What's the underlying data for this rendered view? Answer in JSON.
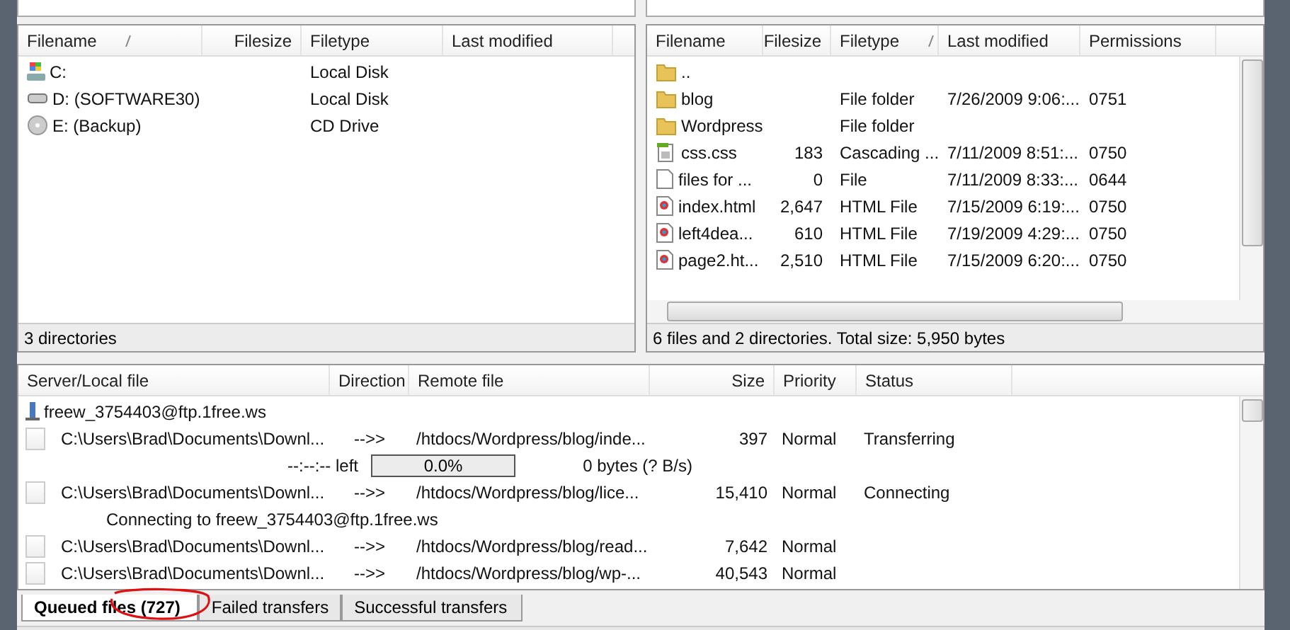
{
  "local": {
    "columns": [
      {
        "label": "Filename",
        "sorted": true
      },
      {
        "label": "Filesize",
        "sorted": false
      },
      {
        "label": "Filetype",
        "sorted": false
      },
      {
        "label": "Last modified",
        "sorted": false
      }
    ],
    "rows": [
      {
        "kind": "windows-drive",
        "name": "C:",
        "type": "Local Disk"
      },
      {
        "kind": "drive",
        "name": "D: (SOFTWARE30)",
        "type": "Local Disk"
      },
      {
        "kind": "cd",
        "name": "E: (Backup)",
        "type": "CD Drive"
      }
    ],
    "status": "3 directories"
  },
  "remote": {
    "columns": [
      {
        "label": "Filename",
        "sorted": false
      },
      {
        "label": "Filesize",
        "sorted": false
      },
      {
        "label": "Filetype",
        "sorted": true
      },
      {
        "label": "Last modified",
        "sorted": false
      },
      {
        "label": "Permissions",
        "sorted": false
      }
    ],
    "rows": [
      {
        "kind": "folder",
        "name": ".."
      },
      {
        "kind": "folder",
        "name": "blog",
        "type": "File folder",
        "modified": "7/26/2009 9:06:...",
        "perms": "0751"
      },
      {
        "kind": "folder",
        "name": "Wordpress",
        "type": "File folder"
      },
      {
        "kind": "css",
        "name": "css.css",
        "size": "183",
        "type": "Cascading ...",
        "modified": "7/11/2009 8:51:...",
        "perms": "0750"
      },
      {
        "kind": "file",
        "name": "files for ...",
        "size": "0",
        "type": "File",
        "modified": "7/11/2009 8:33:...",
        "perms": "0644"
      },
      {
        "kind": "html",
        "name": "index.html",
        "size": "2,647",
        "type": "HTML File",
        "modified": "7/15/2009 6:19:...",
        "perms": "0750"
      },
      {
        "kind": "html",
        "name": "left4dea...",
        "size": "610",
        "type": "HTML File",
        "modified": "7/19/2009 4:29:...",
        "perms": "0750"
      },
      {
        "kind": "html",
        "name": "page2.ht...",
        "size": "2,510",
        "type": "HTML File",
        "modified": "7/15/2009 6:20:...",
        "perms": "0750"
      }
    ],
    "status": "6 files and 2 directories. Total size: 5,950 bytes"
  },
  "queue": {
    "columns": [
      "Server/Local file",
      "Direction",
      "Remote file",
      "Size",
      "Priority",
      "Status"
    ],
    "rows": [
      {
        "kind": "server",
        "text": "freew_3754403@ftp.1free.ws"
      },
      {
        "kind": "file",
        "local": "C:\\Users\\Brad\\Documents\\Downl...",
        "direction": "-->>",
        "remote": "/htdocs/Wordpress/blog/inde...",
        "size": "397",
        "priority": "Normal",
        "status": "Transferring"
      },
      {
        "kind": "progress",
        "left": "--:--:-- left",
        "percent": "0.0%",
        "level": 0,
        "rate": "0 bytes (? B/s)"
      },
      {
        "kind": "file",
        "local": "C:\\Users\\Brad\\Documents\\Downl...",
        "direction": "-->>",
        "remote": "/htdocs/Wordpress/blog/lice...",
        "size": "15,410",
        "priority": "Normal",
        "status": "Connecting"
      },
      {
        "kind": "message",
        "text": "Connecting to freew_3754403@ftp.1free.ws"
      },
      {
        "kind": "file",
        "local": "C:\\Users\\Brad\\Documents\\Downl...",
        "direction": "-->>",
        "remote": "/htdocs/Wordpress/blog/read...",
        "size": "7,642",
        "priority": "Normal"
      },
      {
        "kind": "file",
        "local": "C:\\Users\\Brad\\Documents\\Downl...",
        "direction": "-->>",
        "remote": "/htdocs/Wordpress/blog/wp-...",
        "size": "40,543",
        "priority": "Normal"
      }
    ]
  },
  "tabs": [
    {
      "label": "Queued files (727)",
      "selected": true,
      "circled": true
    },
    {
      "label": "Failed transfers",
      "selected": false,
      "circled": false
    },
    {
      "label": "Successful transfers",
      "selected": false,
      "circled": false
    }
  ]
}
